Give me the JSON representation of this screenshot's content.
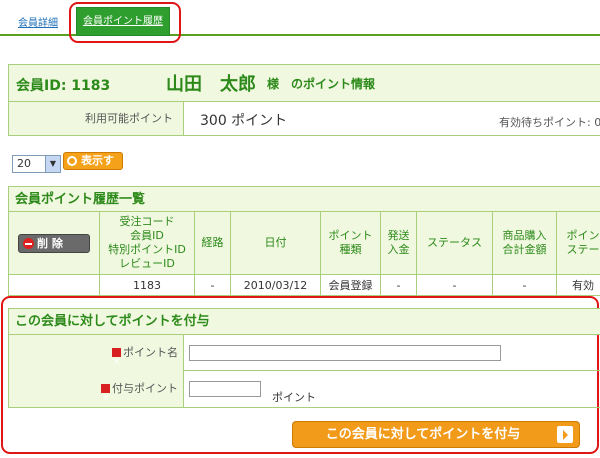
{
  "tabs": {
    "detail": "会員詳細",
    "history": "会員ポイント履歴"
  },
  "member": {
    "id_label": "会員ID: 1183",
    "name": "山田　太郎",
    "suffix": "様　のポイント情報",
    "available_label": "利用可能ポイント",
    "available_value": "300 ポイント",
    "pending_label": "有効待ちポイント: 0 ポ"
  },
  "controls": {
    "per_page": "20",
    "show_button": "表示する"
  },
  "history": {
    "title": "会員ポイント履歴一覧",
    "delete_button": "削 除",
    "columns": [
      "受注コード\n会員ID\n特別ポイントID\nレビューID",
      "経路",
      "日付",
      "ポイント\n種類",
      "発送\n入金",
      "ステータス",
      "商品購入\n合計金額",
      "ポイン\nステー"
    ],
    "rows": [
      [
        "1183",
        "-",
        "2010/03/12",
        "会員登録",
        "-",
        "-",
        "-",
        "有効"
      ]
    ]
  },
  "grant_form": {
    "title": "この会員に対してポイントを付与",
    "point_name_label": "ポイント名",
    "point_name_value": "",
    "grant_points_label": "付与ポイント",
    "grant_points_value": "",
    "unit": "ポイント",
    "submit": "この会員に対してポイントを付与"
  },
  "colors": {
    "green": "#2d8a1a",
    "tab_active": "#2e9f2e",
    "orange": "#f29a1a",
    "highlight": "#e01515"
  }
}
